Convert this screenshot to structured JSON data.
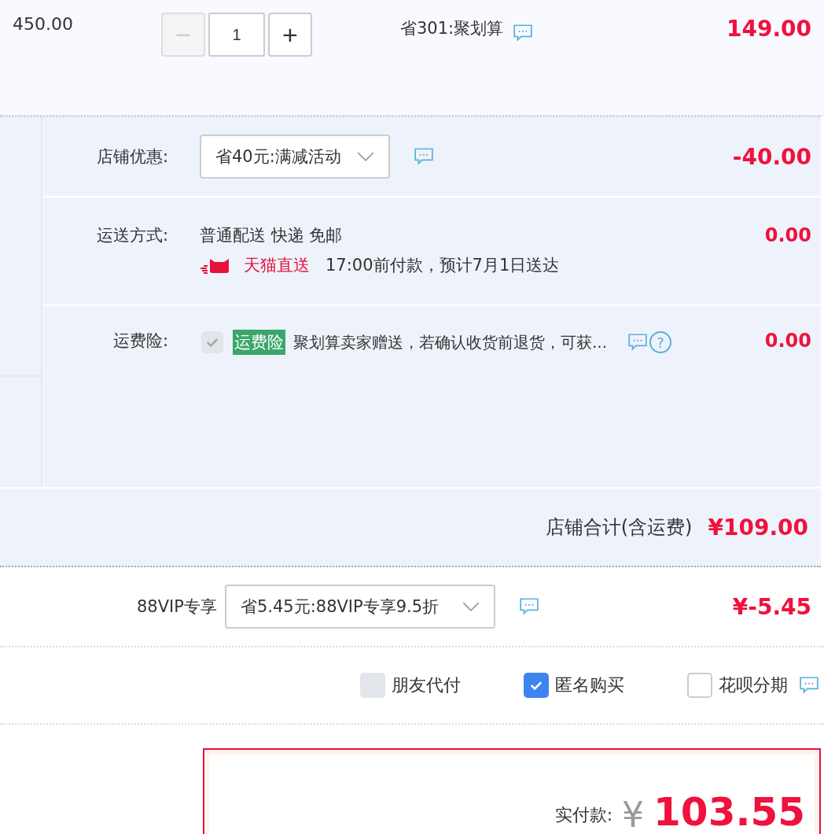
{
  "item": {
    "unit_price": "450.00",
    "quantity": {
      "value": "1",
      "minus": "−",
      "plus": "+",
      "minus_disabled": true
    },
    "promo": "省301:聚划算",
    "amount": "149.00"
  },
  "shop": {
    "discount": {
      "label": "店铺优惠:",
      "selection": "省40元:满减活动",
      "amount": "-40.00"
    },
    "shipping": {
      "label": "运送方式:",
      "method": "普通配送 快递 免邮",
      "badge": "天猫直送",
      "delivery_note": "17:00前付款，预计7月1日送达",
      "amount": "0.00"
    },
    "insurance": {
      "label": "运费险:",
      "checked": true,
      "disabled": true,
      "tag": "运费险",
      "description": "聚划算卖家赠送，若确认收货前退货，可获...",
      "help": "?",
      "amount": "0.00"
    },
    "total": {
      "label": "店铺合计(含运费)",
      "amount": "¥109.00"
    }
  },
  "vip": {
    "label": "88VIP专享",
    "selection": "省5.45元:88VIP专享9.5折",
    "amount": "¥-5.45"
  },
  "options": [
    {
      "label": "朋友代付",
      "checked": false,
      "disabled": true,
      "comment": false
    },
    {
      "label": "匿名购买",
      "checked": true,
      "disabled": false,
      "comment": false
    },
    {
      "label": "花呗分期",
      "checked": false,
      "disabled": false,
      "comment": true
    }
  ],
  "payment": {
    "label": "实付款:",
    "currency": "¥",
    "amount": "103.55"
  }
}
